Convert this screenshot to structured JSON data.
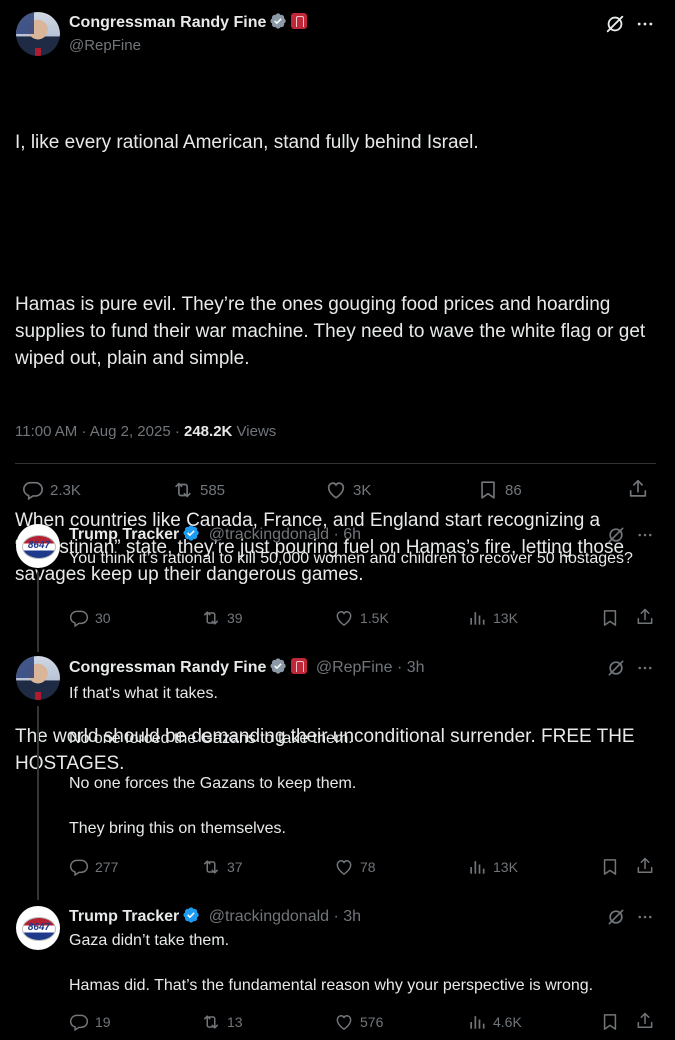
{
  "main_tweet": {
    "name": "Congressman Randy Fine",
    "handle": "@RepFine",
    "paragraphs": [
      "I, like every rational American, stand fully behind Israel.",
      "Hamas is pure evil. They’re the ones gouging food prices and hoarding supplies to fund their war machine. They need to wave the white flag or get wiped out, plain and simple.",
      "When countries like Canada, France, and England start recognizing a “Palestinian” state, they’re just pouring fuel on Hamas’s fire, letting those savages keep up their dangerous games.",
      "The world should be demanding their unconditional surrender. FREE THE HOSTAGES."
    ],
    "timestamp": "11:00 AM · Aug 2, 2025 · ",
    "views_count": "248.2K",
    "views_label": " Views",
    "stats": {
      "replies": "2.3K",
      "reposts": "585",
      "likes": "3K",
      "bookmarks": "86"
    }
  },
  "replies": [
    {
      "name": "Trump Tracker",
      "handle": "@trackingdonald · 6h",
      "avatar_text": "8647",
      "text": "You think it’s rational to kill 50,000 women and children to recover 50 hostages?",
      "stats": {
        "replies": "30",
        "reposts": "39",
        "likes": "1.5K",
        "views": "13K"
      }
    },
    {
      "name": "Congressman Randy Fine",
      "handle": "@RepFine · 3h",
      "text": "If that's what it takes.\n\nNo one forced the Gazans to take them.\n\nNo one forces the Gazans to keep them.\n\nThey bring this on themselves.",
      "stats": {
        "replies": "277",
        "reposts": "37",
        "likes": "78",
        "views": "13K"
      }
    },
    {
      "name": "Trump Tracker",
      "handle": "@trackingdonald · 3h",
      "avatar_text": "8647",
      "text": "Gaza didn’t take them.\n\nHamas did. That’s the fundamental reason why your perspective is wrong.",
      "stats": {
        "replies": "19",
        "reposts": "13",
        "likes": "576",
        "views": "4.6K"
      }
    }
  ],
  "icons": [
    "grok-icon",
    "more-icon",
    "reply-icon",
    "repost-icon",
    "like-icon",
    "bookmark-icon",
    "share-icon",
    "views-icon",
    "verified-icon",
    "government-badge-icon"
  ],
  "colors": {
    "background": "#000000",
    "text": "#e7e9ea",
    "secondary": "#71767b",
    "verified": "#1d9bf0",
    "divider": "#2f3336"
  }
}
